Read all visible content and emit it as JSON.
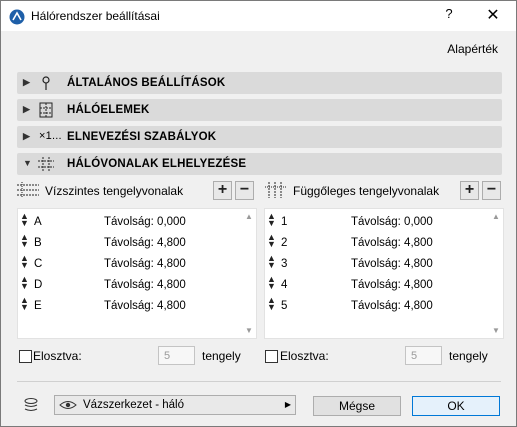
{
  "window": {
    "title": "Hálórendszer beállításai",
    "help": "?",
    "close": "✕"
  },
  "defaults_label": "Alapérték",
  "sections": [
    {
      "label": "ÁLTALÁNOS BEÁLLÍTÁSOK",
      "icon": "pin-icon",
      "expanded": false
    },
    {
      "label": "HÁLÓELEMEK",
      "icon": "grid-element-icon",
      "expanded": false
    },
    {
      "label": "ELNEVEZÉSI SZABÁLYOK",
      "icon": "naming-icon",
      "prefix": "×1...",
      "expanded": false
    },
    {
      "label": "HÁLÓVONALAK ELHELYEZÉSE",
      "icon": "grid-lines-icon",
      "expanded": true
    }
  ],
  "horizontal": {
    "title": "Vízszintes tengelyvonalak",
    "add": "+",
    "remove": "−",
    "rows": [
      {
        "name": "A",
        "distance": "Távolság: 0,000"
      },
      {
        "name": "B",
        "distance": "Távolság: 4,800"
      },
      {
        "name": "C",
        "distance": "Távolság: 4,800"
      },
      {
        "name": "D",
        "distance": "Távolság: 4,800"
      },
      {
        "name": "E",
        "distance": "Távolság: 4,800"
      }
    ],
    "distribute_label": "Elosztva:",
    "count": "5",
    "unit": "tengely"
  },
  "vertical": {
    "title": "Függőleges tengelyvonalak",
    "add": "+",
    "remove": "−",
    "rows": [
      {
        "name": "1",
        "distance": "Távolság: 0,000"
      },
      {
        "name": "2",
        "distance": "Távolság: 4,800"
      },
      {
        "name": "3",
        "distance": "Távolság: 4,800"
      },
      {
        "name": "4",
        "distance": "Távolság: 4,800"
      },
      {
        "name": "5",
        "distance": "Távolság: 4,800"
      }
    ],
    "distribute_label": "Elosztva:",
    "count": "5",
    "unit": "tengely"
  },
  "footer": {
    "layer_value": "Vázszerkezet - háló",
    "cancel": "Mégse",
    "ok": "OK"
  },
  "colors": {
    "section_bg": "#dadada",
    "dialog_bg": "#f0f0f0",
    "ok_border": "#0078d7"
  }
}
